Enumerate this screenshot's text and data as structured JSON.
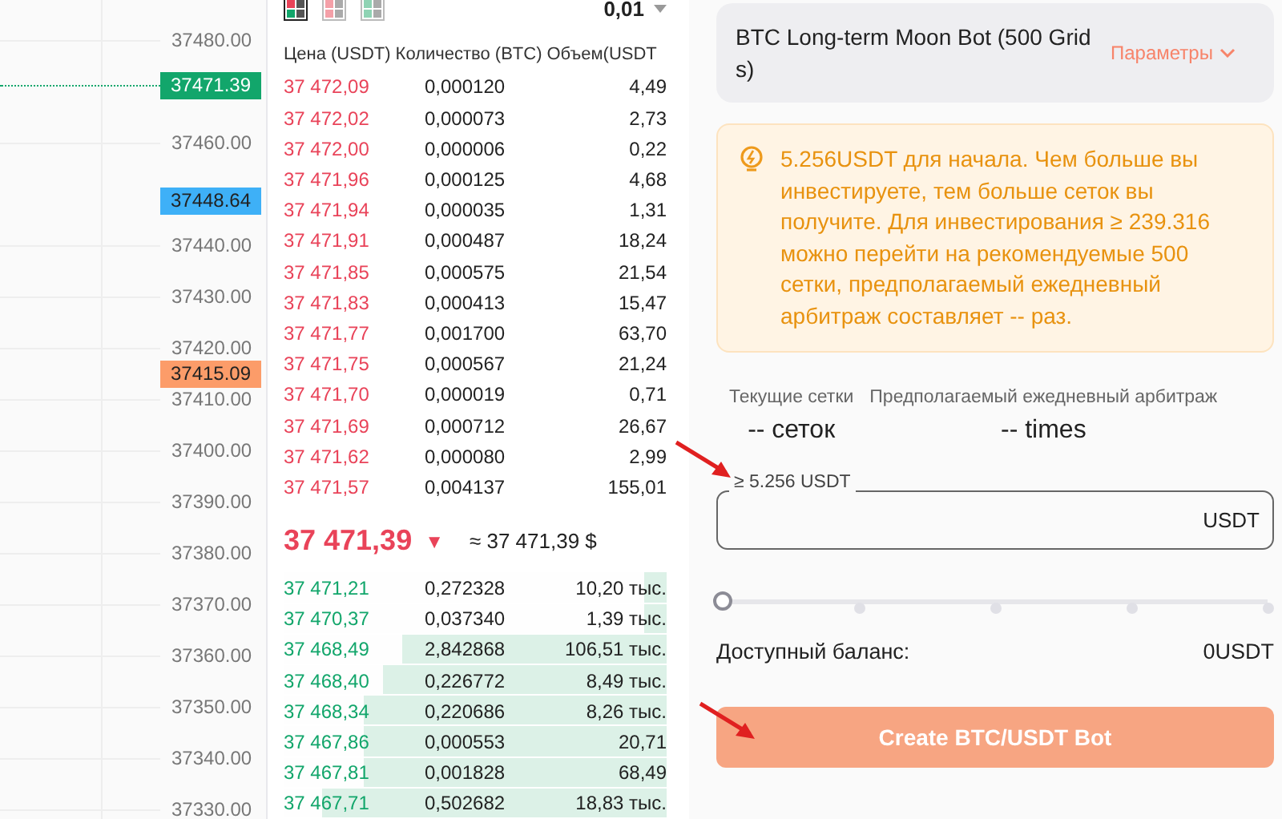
{
  "price_axis": {
    "ticks": [
      "37480.00",
      "37460.00",
      "37440.00",
      "37430.00",
      "37420.00",
      "37410.00",
      "37400.00",
      "37390.00",
      "37380.00",
      "37370.00",
      "37360.00",
      "37350.00",
      "37340.00",
      "37330.00"
    ],
    "tags": [
      {
        "label": "37471.39",
        "color": "#12a66b"
      },
      {
        "label": "37448.64",
        "color": "#3eb0f7"
      },
      {
        "label": "37415.09",
        "color": "#fc9c69"
      }
    ]
  },
  "order_book": {
    "views": [
      {
        "kind": "both",
        "selected": true
      },
      {
        "kind": "asks",
        "selected": false
      },
      {
        "kind": "bids",
        "selected": false
      }
    ],
    "precision": "0,01",
    "columns": [
      "Цена (USDT)",
      "Количество (BTC)",
      "Объем(USDT"
    ],
    "asks": [
      {
        "price": "37 472,09",
        "amount": "0,000120",
        "total": "4,49"
      },
      {
        "price": "37 472,02",
        "amount": "0,000073",
        "total": "2,73"
      },
      {
        "price": "37 472,00",
        "amount": "0,000006",
        "total": "0,22"
      },
      {
        "price": "37 471,96",
        "amount": "0,000125",
        "total": "4,68"
      },
      {
        "price": "37 471,94",
        "amount": "0,000035",
        "total": "1,31"
      },
      {
        "price": "37 471,91",
        "amount": "0,000487",
        "total": "18,24"
      },
      {
        "price": "37 471,85",
        "amount": "0,000575",
        "total": "21,54"
      },
      {
        "price": "37 471,83",
        "amount": "0,000413",
        "total": "15,47"
      },
      {
        "price": "37 471,77",
        "amount": "0,001700",
        "total": "63,70"
      },
      {
        "price": "37 471,75",
        "amount": "0,000567",
        "total": "21,24"
      },
      {
        "price": "37 471,70",
        "amount": "0,000019",
        "total": "0,71"
      },
      {
        "price": "37 471,69",
        "amount": "0,000712",
        "total": "26,67"
      },
      {
        "price": "37 471,62",
        "amount": "0,000080",
        "total": "2,99"
      },
      {
        "price": "37 471,57",
        "amount": "0,004137",
        "total": "155,01"
      }
    ],
    "last_price": "37 471,39",
    "last_price_arrow": "▼",
    "last_price_usd": "≈ 37 471,39 $",
    "bids": [
      {
        "price": "37 471,21",
        "amount": "0,272328",
        "total": "10,20 тыс.",
        "level": 0.06
      },
      {
        "price": "37 470,37",
        "amount": "0,037340",
        "total": "1,39 тыс.",
        "level": 0.06
      },
      {
        "price": "37 468,49",
        "amount": "2,842868",
        "total": "106,51 тыс.",
        "level": 0.69
      },
      {
        "price": "37 468,40",
        "amount": "0,226772",
        "total": "8,49 тыс.",
        "level": 0.74
      },
      {
        "price": "37 468,34",
        "amount": "0,220686",
        "total": "8,26 тыс.",
        "level": 0.79
      },
      {
        "price": "37 467,86",
        "amount": "0,000553",
        "total": "20,71",
        "level": 0.79
      },
      {
        "price": "37 467,81",
        "amount": "0,001828",
        "total": "68,49",
        "level": 0.79
      },
      {
        "price": "37 467,71",
        "amount": "0,502682",
        "total": "18,83 тыс.",
        "level": 0.9
      }
    ]
  },
  "bot": {
    "title": "BTC Long-term Moon Bot (500 Grid s)",
    "params_link": "Параметры",
    "tip": "5.256USDT для начала. Чем больше вы инвестируете, тем больше сеток вы получите. Для инвестирования ≥ 239.316 можно перейти на рекомендуемые 500 сетки, предполагаемый ежедневный арбитраж составляет -- раз.",
    "stats": [
      {
        "label": "Текущие сетки",
        "value": "-- сеток"
      },
      {
        "label": "Предполагаемый ежедневный арбитраж",
        "value": "-- times"
      }
    ],
    "amount_field": {
      "placeholder": "≥ 5.256 USDT",
      "unit": "USDT"
    },
    "slider": {
      "level": 0
    },
    "balance_label": "Доступный баланс:",
    "balance_value": "0USDT",
    "create_button": {
      "label": "Create BTC/USDT Bot",
      "disabled": true
    }
  },
  "annotations": [
    {
      "kind": "arrow"
    },
    {
      "kind": "arrow"
    }
  ]
}
